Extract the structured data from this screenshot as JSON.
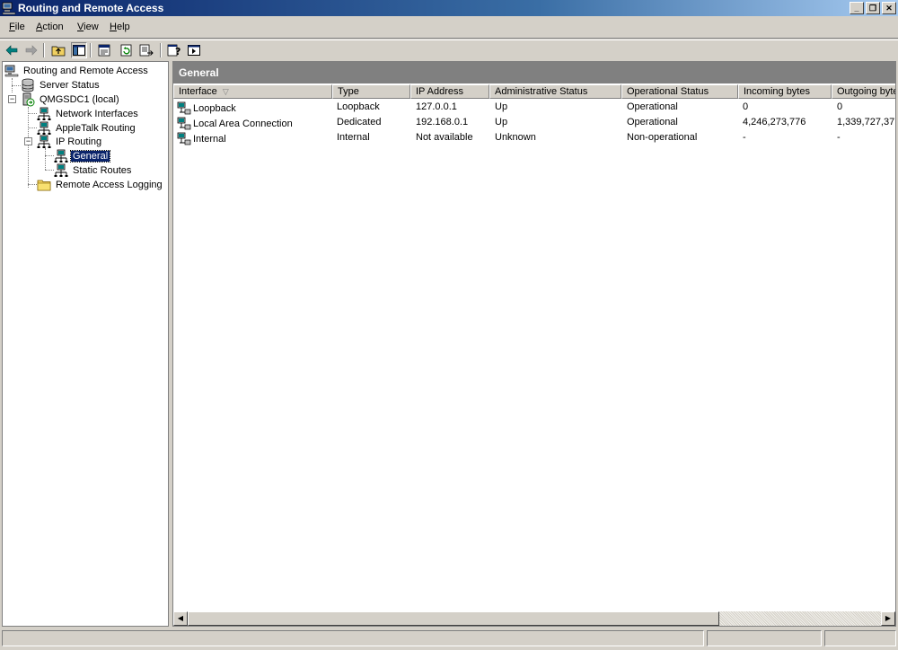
{
  "window": {
    "title": "Routing and Remote Access",
    "controls": {
      "minimize": "_",
      "restore": "❐",
      "close": "✕"
    }
  },
  "menu": {
    "items": [
      {
        "mnemonic": "F",
        "rest": "ile"
      },
      {
        "mnemonic": "A",
        "rest": "ction"
      },
      {
        "mnemonic": "V",
        "rest": "iew"
      },
      {
        "mnemonic": "H",
        "rest": "elp"
      }
    ]
  },
  "toolbar": {
    "icons": [
      "back-icon",
      "forward-icon",
      "up-folder-icon",
      "show-hide-tree-icon",
      "properties-icon",
      "refresh-icon",
      "export-list-icon",
      "help-icon",
      "show-hide-action-pane-icon"
    ]
  },
  "tree": {
    "root": "Routing and Remote Access",
    "server_status": "Server Status",
    "server": "QMGSDC1 (local)",
    "network_interfaces": "Network Interfaces",
    "appletalk": "AppleTalk Routing",
    "ip_routing": "IP Routing",
    "general": "General",
    "static_routes": "Static Routes",
    "remote_access_logging": "Remote Access Logging",
    "expander_open": "−"
  },
  "details": {
    "header": "General",
    "sort_glyph": "▽",
    "columns": [
      "Interface",
      "Type",
      "IP Address",
      "Administrative Status",
      "Operational Status",
      "Incoming bytes",
      "Outgoing bytes"
    ],
    "rows": [
      [
        "Loopback",
        "Loopback",
        "127.0.0.1",
        "Up",
        "Operational",
        "0",
        "0"
      ],
      [
        "Local Area Connection",
        "Dedicated",
        "192.168.0.1",
        "Up",
        "Operational",
        "4,246,273,776",
        "1,339,727,37"
      ],
      [
        "Internal",
        "Internal",
        "Not available",
        "Unknown",
        "Non-operational",
        "-",
        "-"
      ]
    ]
  },
  "scrollbar": {
    "left": "◀",
    "right": "▶"
  },
  "colors": {
    "titlebar_start": "#0a246a",
    "titlebar_end": "#a6caf0",
    "panel_header": "#808080",
    "selection": "#0a246a",
    "face": "#d4d0c8"
  }
}
